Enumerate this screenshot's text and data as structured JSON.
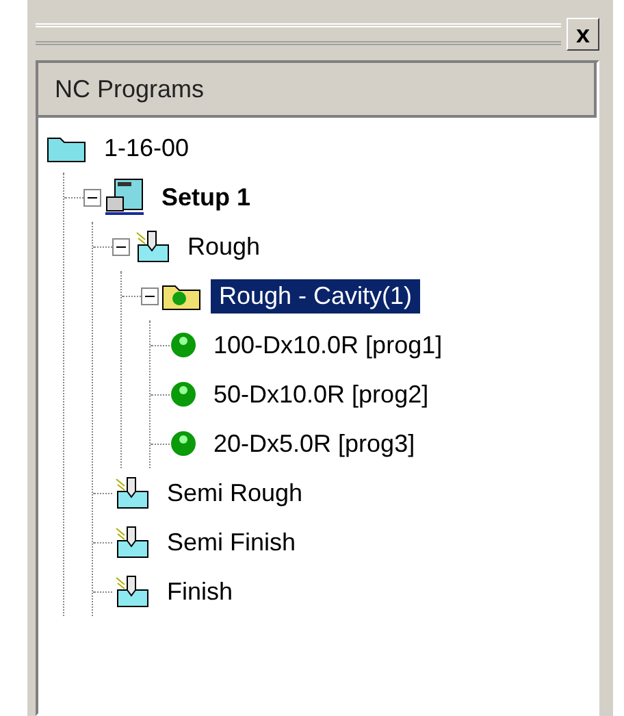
{
  "panel": {
    "close": "x",
    "header": "NC Programs"
  },
  "tree": [
    {
      "kind": "root",
      "label": "1-16-00",
      "selected": false,
      "children": [
        {
          "kind": "setup",
          "label": "Setup 1",
          "expanded": true,
          "selected": false,
          "children": [
            {
              "kind": "operation",
              "label": "Rough",
              "expanded": true,
              "selected": false,
              "children": [
                {
                  "kind": "folder",
                  "label": "Rough - Cavity(1)",
                  "expanded": true,
                  "selected": true,
                  "children": [
                    {
                      "kind": "program",
                      "label": "100-Dx10.0R [prog1]",
                      "selected": false
                    },
                    {
                      "kind": "program",
                      "label": "50-Dx10.0R [prog2]",
                      "selected": false
                    },
                    {
                      "kind": "program",
                      "label": "20-Dx5.0R [prog3]",
                      "selected": false
                    }
                  ]
                }
              ]
            },
            {
              "kind": "operation",
              "label": "Semi Rough",
              "selected": false
            },
            {
              "kind": "operation",
              "label": "Semi Finish",
              "selected": false
            },
            {
              "kind": "operation",
              "label": "Finish",
              "selected": false
            }
          ]
        }
      ]
    }
  ]
}
